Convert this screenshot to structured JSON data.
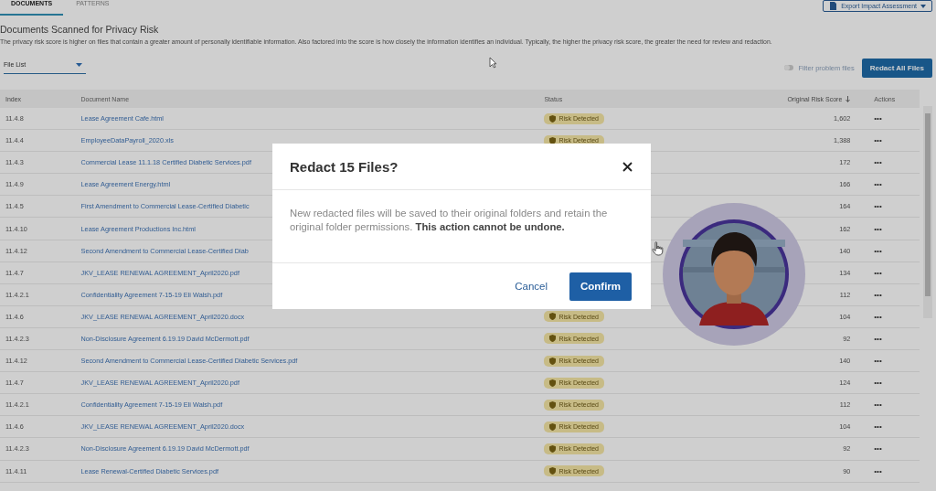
{
  "tabs": [
    {
      "label": "DOCUMENTS",
      "selected": true
    },
    {
      "label": "PATTERNS",
      "selected": false
    }
  ],
  "export_button": {
    "label": "Export Impact Assessment"
  },
  "heading": "Documents Scanned for Privacy Risk",
  "description": "The privacy risk score is higher on files that contain a greater amount of personally identifiable information. Also factored into the score is how closely the information identifies an individual. Typically, the higher the privacy risk score, the greater the need for review and redaction.",
  "view_select": {
    "value": "File List"
  },
  "filter_toggle": {
    "label": "Filter problem files",
    "on": false,
    "disabled": true
  },
  "redact_button": {
    "label": "Redact All Files"
  },
  "table": {
    "columns": [
      {
        "label": "Index",
        "sorted": false
      },
      {
        "label": "Document Name",
        "sorted": false
      },
      {
        "label": "Status",
        "sorted": false
      },
      {
        "label": "Original Risk Score",
        "sorted": true
      },
      {
        "label": "Actions",
        "sorted": false
      }
    ],
    "rows": [
      {
        "index": "11.4.8",
        "name": "Lease Agreement Cafe.html",
        "status": "Risk Detected",
        "score": "1,602",
        "actions": "•••"
      },
      {
        "index": "11.4.4",
        "name": "EmployeeDataPayroll_2020.xls",
        "status": "Risk Detected",
        "score": "1,388",
        "actions": "•••"
      },
      {
        "index": "11.4.3",
        "name": "Commercial Lease 11.1.18 Certified Diabetic Services.pdf",
        "score": "172",
        "actions": "•••"
      },
      {
        "index": "11.4.9",
        "name": "Lease Agreement Energy.html",
        "score": "166",
        "actions": "•••"
      },
      {
        "index": "11.4.5",
        "name": "First Amendment to Commercial Lease-Certified Diabetic",
        "score": "164",
        "actions": "•••"
      },
      {
        "index": "11.4.10",
        "name": "Lease Agreement Productions Inc.html",
        "score": "162",
        "actions": "•••"
      },
      {
        "index": "11.4.12",
        "name": "Second Amendment to Commercial Lease-Certified Diab",
        "score": "140",
        "actions": "•••"
      },
      {
        "index": "11.4.7",
        "name": "JKV_LEASE RENEWAL AGREEMENT_April2020.pdf",
        "score": "134",
        "actions": "•••"
      },
      {
        "index": "11.4.2.1",
        "name": "Confidentiality Agreement 7-15-19 Eli Walsh.pdf",
        "score": "112",
        "actions": "•••"
      },
      {
        "index": "11.4.6",
        "name": "JKV_LEASE RENEWAL AGREEMENT_April2020.docx",
        "status": "Risk Detected",
        "score": "104",
        "actions": "•••"
      },
      {
        "index": "11.4.2.3",
        "name": "Non-Disclosure Agreement 6.19.19 David McDermott.pdf",
        "status": "Risk Detected",
        "score": "92",
        "actions": "•••"
      },
      {
        "index": "11.4.12",
        "name": "Second Amendment to Commercial Lease-Certified Diabetic Services.pdf",
        "status": "Risk Detected",
        "score": "140",
        "actions": "•••"
      },
      {
        "index": "11.4.7",
        "name": "JKV_LEASE RENEWAL AGREEMENT_April2020.pdf",
        "status": "Risk Detected",
        "score": "124",
        "actions": "•••"
      },
      {
        "index": "11.4.2.1",
        "name": "Confidentiality Agreement 7-15-19 Eli Walsh.pdf",
        "status": "Risk Detected",
        "score": "112",
        "actions": "•••"
      },
      {
        "index": "11.4.6",
        "name": "JKV_LEASE RENEWAL AGREEMENT_April2020.docx",
        "status": "Risk Detected",
        "score": "104",
        "actions": "•••"
      },
      {
        "index": "11.4.2.3",
        "name": "Non-Disclosure Agreement 6.19.19 David McDermott.pdf",
        "status": "Risk Detected",
        "score": "92",
        "actions": "•••"
      },
      {
        "index": "11.4.11",
        "name": "Lease Renewal-Certified Diabetic Services.pdf",
        "status": "Risk Detected",
        "score": "90",
        "actions": "•••"
      }
    ]
  },
  "modal": {
    "title": "Redact 15 Files?",
    "body": "New redacted files will be saved to their original folders and retain the original folder permissions. **This action cannot be undone.**",
    "cancel": "Cancel",
    "confirm": "Confirm"
  }
}
